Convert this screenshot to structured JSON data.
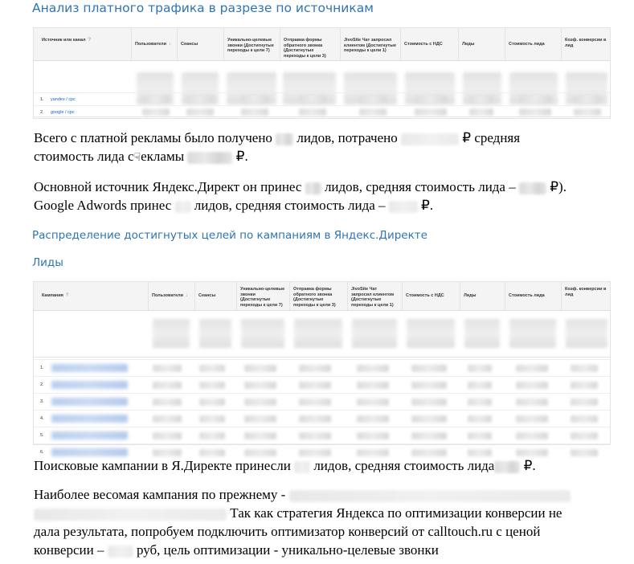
{
  "heading_main": "Анализ платного трафика в разрезе по источникам",
  "table_sources": {
    "columns": [
      "Источник или канал",
      "Пользователи",
      "Сеансы",
      "Уникально-целевые звонки (Достигнутые переходы к цели 7)",
      "Отправка формы обратного звонка (Достигнутые переходы к цели 3)",
      "JivoSite Чат запросил клиентом (Достигнутые переходы к цели 1)",
      "Стоимость с НДС",
      "Лиды",
      "Стоимость лида",
      "Коэф. конверсии в лид"
    ],
    "rows": [
      {
        "num": "1.",
        "name": "yandex / cpc"
      },
      {
        "num": "2.",
        "name": "google / cpc"
      }
    ]
  },
  "para1": {
    "a": "Всего с платной рекламы было получено",
    "b": "лидов, потрачено",
    "c": "₽ средняя",
    "d": "стоимость лида с",
    "e": "екламы",
    "f": "₽."
  },
  "para2": {
    "a": "Основной источник Яндекс.Директ он принес",
    "b": "лидов, средняя стоимость лида –",
    "c": "₽).",
    "d": "Google Adwords принес",
    "e": "лидов, средняя стоимость лида –",
    "f": "₽."
  },
  "heading_campaigns": "Распределение достигнутых целей по кампаниям в Яндекс.Директе",
  "heading_leads": "Лиды",
  "table_campaigns": {
    "columns": [
      "Кампания",
      "Пользователи",
      "Сеансы",
      "Уникально-целевые звонки (Достигнутые переходы к цели 7)",
      "Отправка формы обратного звонка (Достигнутые переходы к цели 3)",
      "JivoSite Чат запросил клиентом (Достигнутые переходы к цели 1)",
      "Стоимость с НДС",
      "Лиды",
      "Стоимость лида",
      "Коэф. конверсии в лид"
    ],
    "rows": [
      {
        "num": "1."
      },
      {
        "num": "2."
      },
      {
        "num": "3."
      },
      {
        "num": "4."
      },
      {
        "num": "5."
      },
      {
        "num": "6."
      }
    ]
  },
  "para3": {
    "a": "Поисковые кампании в Я.Директе принесли",
    "b": "лидов, средняя стоимость лида",
    "c": "₽."
  },
  "para4": {
    "a": "Наиболее весомая кампания по прежнему -",
    "b": "Так как стратегия Яндекса по оптимизации конверсии не",
    "c": "дала результата, попробуем подключить оптимизатор конверсий от calltouch.ru с ценой",
    "d": "конверсии –",
    "e": "руб, цель оптимизации - уникально-целевые звонки"
  },
  "colors": {
    "heading": "#2e74b5",
    "link": "#1a62c8"
  }
}
